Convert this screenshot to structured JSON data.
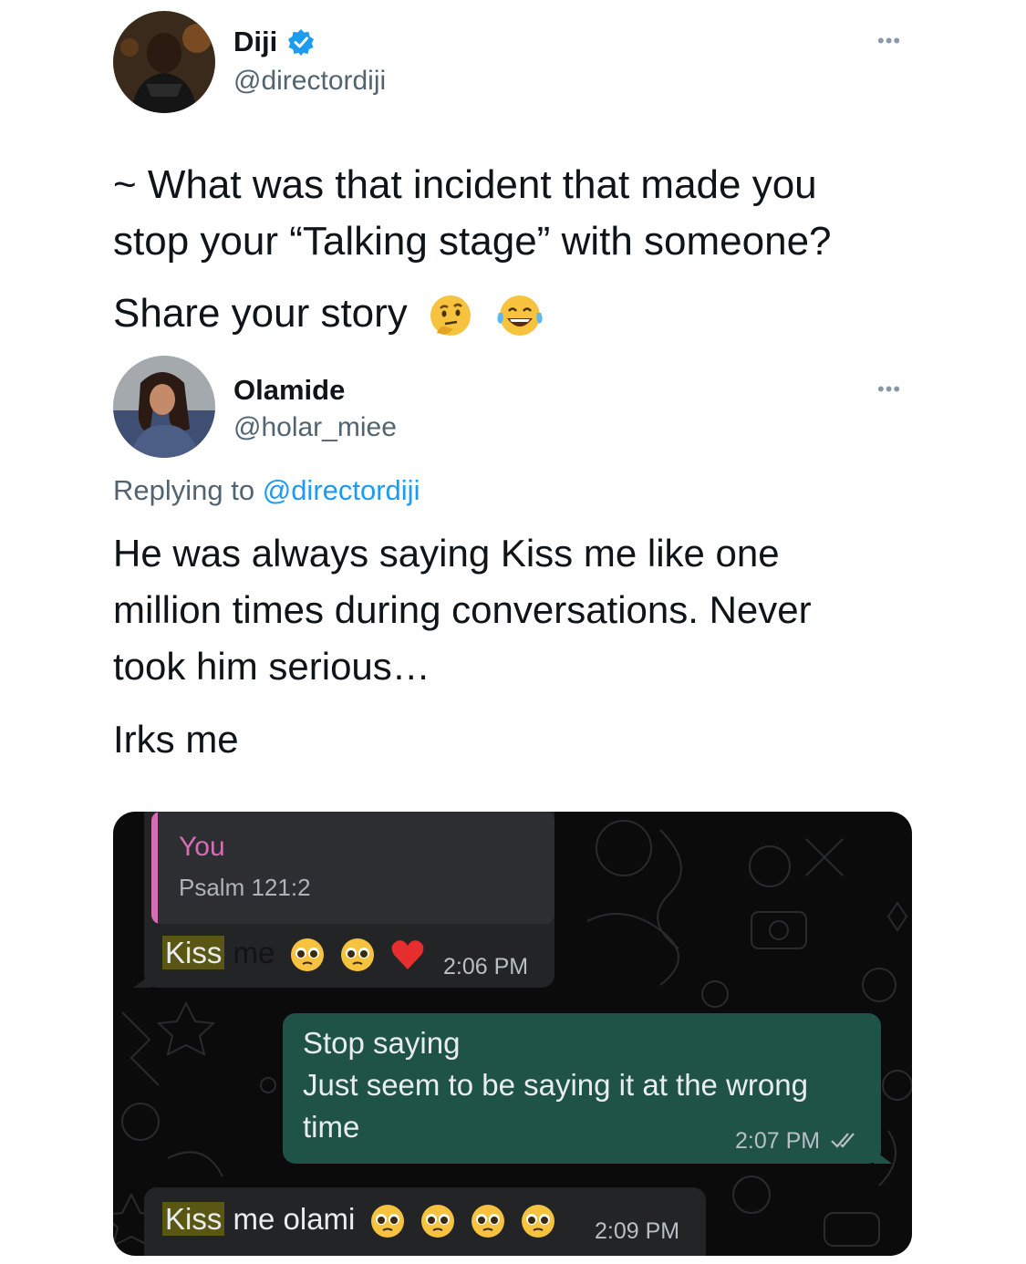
{
  "original_tweet": {
    "display_name": "Diji",
    "handle": "@directordiji",
    "verified": true,
    "line1": "~ What was that incident that made you",
    "line2": "stop your “Talking stage” with someone?",
    "line3": "Share your story",
    "emojis": [
      "thinking-face",
      "tears-of-joy"
    ]
  },
  "reply_tweet": {
    "display_name": "Olamide",
    "handle": "@holar_miee",
    "replying_label": "Replying to",
    "replying_to": "@directordiji",
    "line1": "He was always saying Kiss me like one",
    "line2": "million times during conversations. Never",
    "line3": "took him serious…",
    "line4": "Irks me"
  },
  "chat": {
    "quoted_sender": "You",
    "quoted_text": "Psalm 121:2",
    "msg1": {
      "highlight": "Kiss",
      "rest": " me",
      "time": "2:06 PM",
      "emojis": [
        "pleading-face",
        "pleading-face",
        "red-heart"
      ]
    },
    "msg2": {
      "line1": "Stop saying",
      "line2": "Just seem to be saying it at the wrong",
      "line3": "time",
      "time": "2:07 PM",
      "status": "read-double-check"
    },
    "msg3": {
      "highlight": "Kiss",
      "rest": " me olami",
      "time": "2:09 PM",
      "emojis": [
        "pleading-face",
        "pleading-face",
        "pleading-face",
        "pleading-face"
      ]
    }
  },
  "colors": {
    "link": "#1d9bf0",
    "verified": "#1d9bf0",
    "incoming_bubble": "#232426",
    "outgoing_bubble": "#1f5348",
    "quote_accent": "#d46eb4",
    "search_highlight": "#5a5614"
  }
}
